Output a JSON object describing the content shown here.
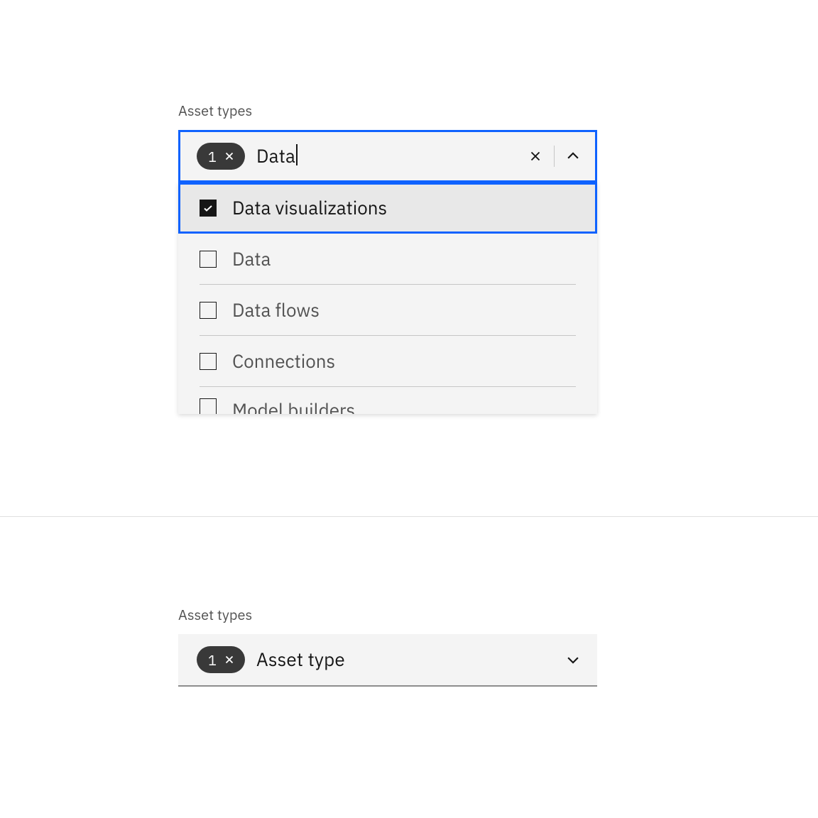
{
  "multiselect_open": {
    "label": "Asset types",
    "tag_count": "1",
    "input_value": "Data",
    "options": [
      {
        "label": "Data visualizations",
        "checked": true,
        "highlighted": true
      },
      {
        "label": "Data",
        "checked": false,
        "highlighted": false
      },
      {
        "label": "Data flows",
        "checked": false,
        "highlighted": false
      },
      {
        "label": "Connections",
        "checked": false,
        "highlighted": false
      },
      {
        "label": "Model builders",
        "checked": false,
        "highlighted": false
      }
    ]
  },
  "multiselect_closed": {
    "label": "Asset types",
    "tag_count": "1",
    "placeholder": "Asset type"
  }
}
